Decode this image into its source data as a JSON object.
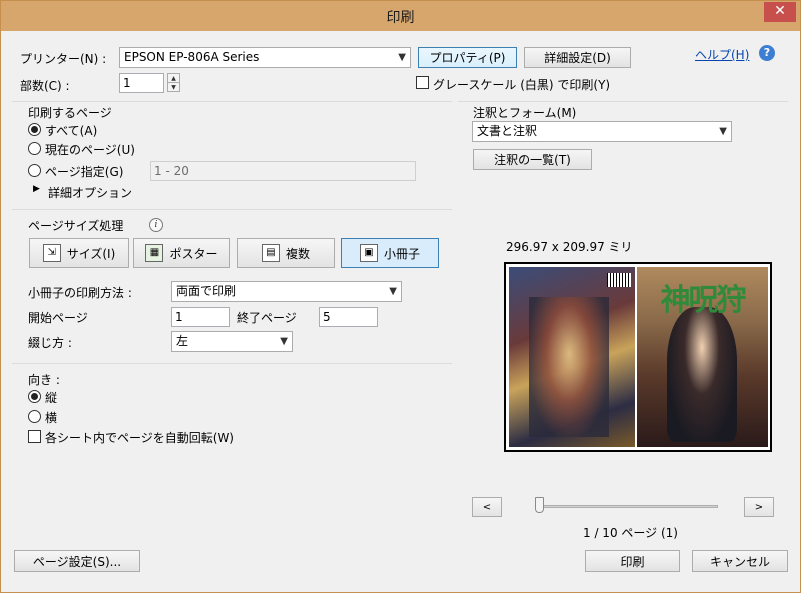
{
  "window": {
    "title": "印刷",
    "close_glyph": "✕"
  },
  "printer": {
    "label": "プリンター(N) :",
    "selected": "EPSON EP-806A Series",
    "properties_label": "プロパティ(P)",
    "advanced_label": "詳細設定(D)",
    "help_label": "ヘルプ(H)"
  },
  "copies": {
    "label": "部数(C) :",
    "value": "1",
    "grayscale_label": "グレースケール (白黒) で印刷(Y)"
  },
  "pages": {
    "heading": "印刷するページ",
    "all_label": "すべて(A)",
    "current_label": "現在のページ(U)",
    "range_label": "ページ指定(G)",
    "range_placeholder": "1 - 20",
    "more_options_label": "詳細オプション"
  },
  "page_size": {
    "heading": "ページサイズ処理",
    "buttons": [
      {
        "label": "サイズ(I)",
        "icon": "fit-size-icon"
      },
      {
        "label": "ポスター",
        "icon": "poster-icon"
      },
      {
        "label": "複数",
        "icon": "multiple-icon"
      },
      {
        "label": "小冊子",
        "icon": "booklet-icon"
      }
    ],
    "booklet_method_label": "小冊子の印刷方法 :",
    "booklet_method_value": "両面で印刷",
    "start_page_label": "開始ページ",
    "start_page_value": "1",
    "end_page_label": "終了ページ",
    "end_page_value": "5",
    "binding_label": "綴じ方 :",
    "binding_value": "左"
  },
  "orientation": {
    "heading": "向き :",
    "portrait_label": "縦",
    "landscape_label": "横",
    "auto_rotate_label": "各シート内でページを自動回転(W)"
  },
  "comments": {
    "heading": "注釈とフォーム(M)",
    "value": "文書と注釈",
    "summary_label": "注釈の一覧(T)"
  },
  "preview": {
    "dimensions": "296.97 x 209.97 ミリ",
    "cover_title": "神呪狩",
    "prev_glyph": "<",
    "next_glyph": ">",
    "page_status": "1 / 10 ページ (1)"
  },
  "footer": {
    "page_setup_label": "ページ設定(S)...",
    "print_label": "印刷",
    "cancel_label": "キャンセル"
  }
}
